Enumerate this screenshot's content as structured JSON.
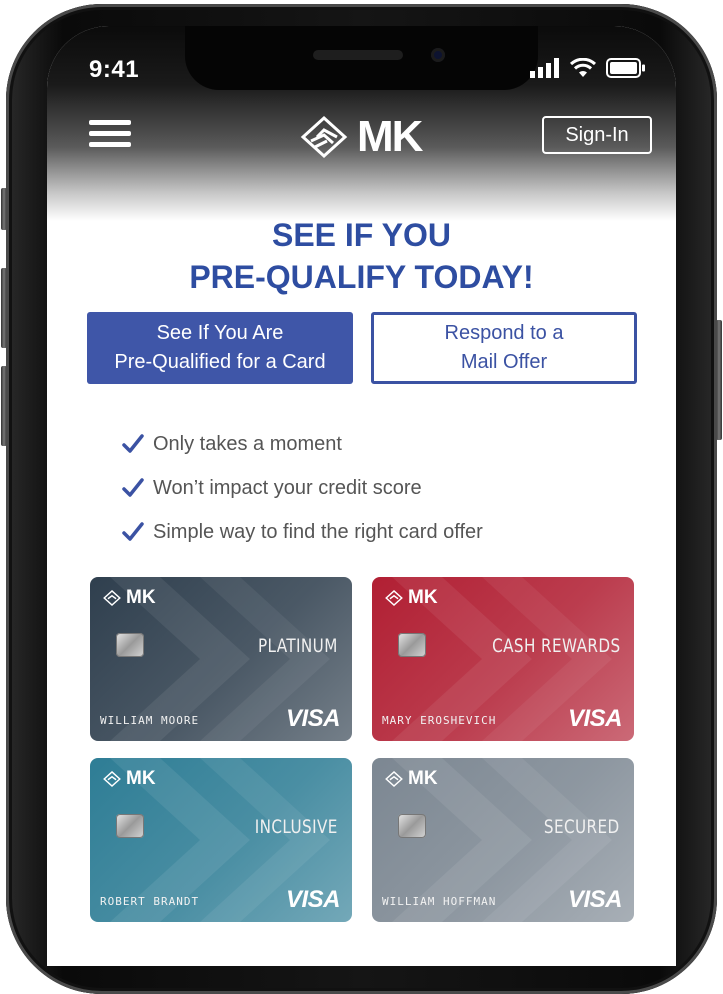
{
  "status_bar": {
    "time": "9:41"
  },
  "header": {
    "brand": "MK",
    "signin_label": "Sign-In"
  },
  "hero": {
    "headline_line1": "SEE IF YOU",
    "headline_line2": "PRE-QUALIFY TODAY!"
  },
  "actions": {
    "prequalify_line1": "See If You Are",
    "prequalify_line2": "Pre-Qualified for a Card",
    "mail_offer_line1": "Respond to a",
    "mail_offer_line2": "Mail Offer"
  },
  "benefits": [
    {
      "label": "Only takes a moment"
    },
    {
      "label": "Won’t impact your credit score"
    },
    {
      "label": "Simple way to find the right card offer"
    }
  ],
  "cards": [
    {
      "brand": "MK",
      "product": "PLATINUM",
      "holder": "WILLIAM MOORE",
      "network": "VISA",
      "color": "#2f3f4e"
    },
    {
      "brand": "MK",
      "product": "CASH REWARDS",
      "holder": "MARY EROSHEVICH",
      "network": "VISA",
      "color": "#b11f33"
    },
    {
      "brand": "MK",
      "product": "INCLUSIVE",
      "holder": "ROBERT BRANDT",
      "network": "VISA",
      "color": "#2e7d95"
    },
    {
      "brand": "MK",
      "product": "SECURED",
      "holder": "WILLIAM HOFFMAN",
      "network": "VISA",
      "color": "#7c8792"
    }
  ],
  "colors": {
    "accent": "#3f56a8",
    "headline": "#2e4da1",
    "check": "#3b52a3"
  },
  "icons": [
    "menu-icon",
    "mk-logo-icon",
    "cellular-signal-icon",
    "wifi-icon",
    "battery-icon",
    "checkmark-icon",
    "chip-icon"
  ]
}
